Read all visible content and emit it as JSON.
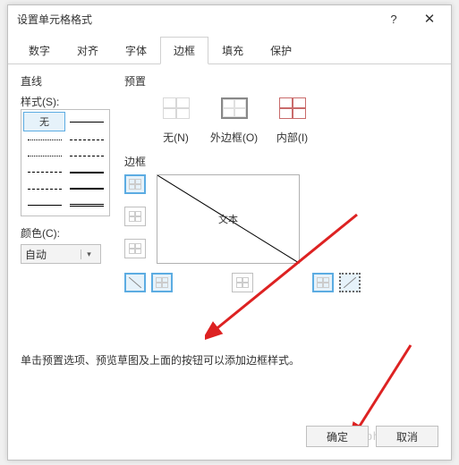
{
  "title": "设置单元格格式",
  "help_symbol": "?",
  "close_symbol": "✕",
  "tabs": [
    "数字",
    "对齐",
    "字体",
    "边框",
    "填充",
    "保护"
  ],
  "active_tab_index": 3,
  "line_section": "直线",
  "style_label": "样式(S):",
  "style_none": "无",
  "color_label": "颜色(C):",
  "color_value": "自动",
  "preset_section": "预置",
  "presets": {
    "none": "无(N)",
    "outline": "外边框(O)",
    "inside": "内部(I)"
  },
  "border_section": "边框",
  "preview_text": "文本",
  "hint": "单击预置选项、预览草图及上面的按钮可以添加边框样式。",
  "buttons": {
    "ok": "确定",
    "cancel": "取消"
  },
  "watermark": "php 中文网"
}
